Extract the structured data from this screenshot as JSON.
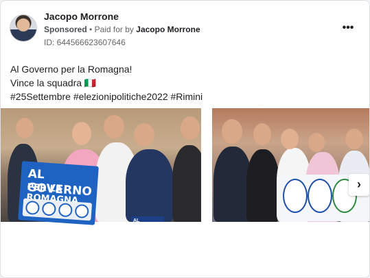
{
  "post": {
    "author": "Jacopo Morrone",
    "sponsored": "Sponsored",
    "separator": "•",
    "paid_for_by": "Paid for by",
    "payer": "Jacopo Morrone",
    "ad_id": "ID: 644566623607646",
    "more_icon": "ellipsis-icon",
    "lines": [
      "Al Governo per la Romagna!",
      "Vince la squadra 🇮🇹",
      "#25Settembre #elezionipolitiche2022 #Rimini"
    ]
  },
  "carousel": {
    "next_icon": "chevron-right-icon",
    "slide1_sign_line1": "AL GOVERNO",
    "slide1_sign_line2": "PER LA ROMAGNA",
    "slide1_banner": "AL GOVERNO"
  },
  "colors": {
    "accent_blue": "#1f63c2",
    "text_primary": "#1c1e21",
    "text_secondary": "#65676b"
  }
}
